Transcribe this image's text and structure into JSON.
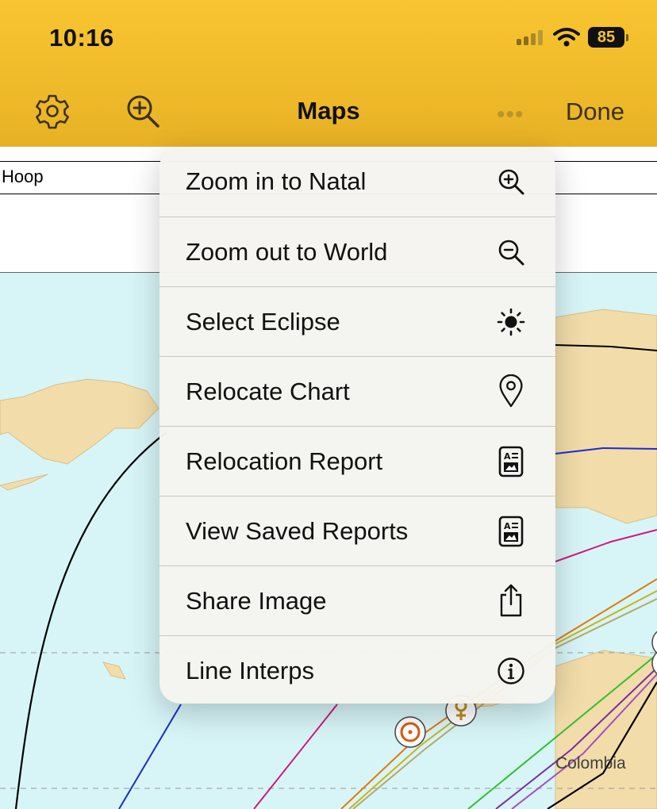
{
  "status_bar": {
    "time": "10:16",
    "battery": "85"
  },
  "nav": {
    "title": "Maps",
    "done_label": "Done",
    "more_label": "•••"
  },
  "chart_header": {
    "name": "Hoop"
  },
  "map": {
    "country_label": "Colombia"
  },
  "menu": {
    "items": [
      {
        "label": "Zoom in to Natal",
        "icon": "zoom-in-icon"
      },
      {
        "label": "Zoom out to World",
        "icon": "zoom-out-icon"
      },
      {
        "label": "Select Eclipse",
        "icon": "sun-icon"
      },
      {
        "label": "Relocate Chart",
        "icon": "map-pin-icon"
      },
      {
        "label": "Relocation Report",
        "icon": "report-icon"
      },
      {
        "label": "View Saved Reports",
        "icon": "report-icon"
      },
      {
        "label": "Share Image",
        "icon": "share-icon"
      },
      {
        "label": "Line Interps",
        "icon": "info-icon"
      }
    ]
  },
  "colors": {
    "header": "#f6c22f",
    "ocean": "#d7f5f7",
    "land": "#f2dca9"
  }
}
